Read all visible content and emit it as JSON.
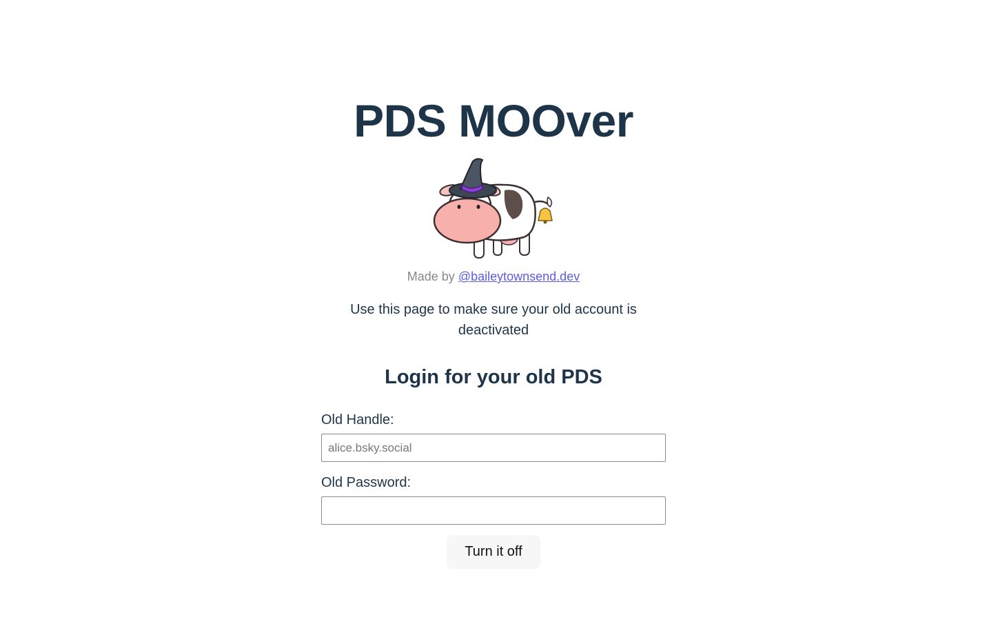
{
  "header": {
    "title": "PDS MOOver"
  },
  "credit": {
    "prefix": "Made by",
    "link_text": "@baileytownsend.dev"
  },
  "intro": {
    "text": "Use this page to make sure your old account is deactivated"
  },
  "login": {
    "heading": "Login for your old PDS",
    "handle_label": "Old Handle:",
    "handle_placeholder": "alice.bsky.social",
    "handle_value": "",
    "password_label": "Old Password:",
    "password_value": "",
    "submit_label": "Turn it off"
  },
  "mascot": {
    "icon": "cow-witch-hat-mascot"
  },
  "colors": {
    "text": "#1e3448",
    "link": "#5b5ce0",
    "muted": "#888888",
    "button_bg": "#f7f7f7"
  }
}
